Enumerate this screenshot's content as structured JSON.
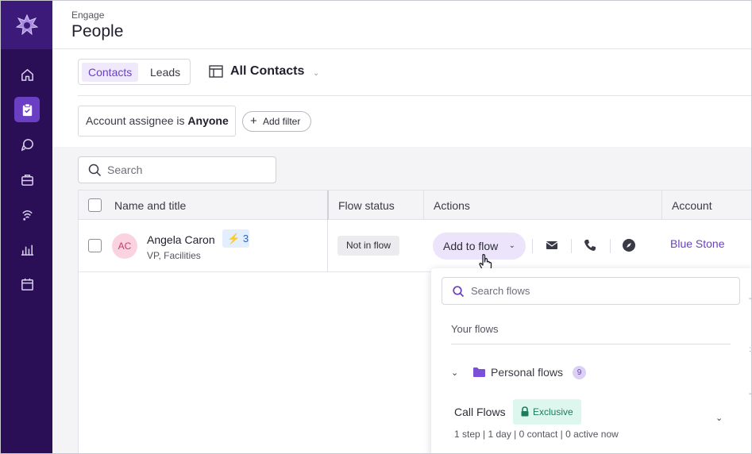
{
  "header": {
    "breadcrumb": "Engage",
    "title": "People"
  },
  "sidebar": {
    "items": [
      {
        "icon": "home-icon",
        "active": false
      },
      {
        "icon": "clipboard-icon",
        "active": true
      },
      {
        "icon": "chat-bubbles-icon",
        "active": false
      },
      {
        "icon": "briefcase-icon",
        "active": false
      },
      {
        "icon": "signal-icon",
        "active": false
      },
      {
        "icon": "bar-chart-icon",
        "active": false
      },
      {
        "icon": "calendar-icon",
        "active": false
      }
    ],
    "colors": {
      "bg": "#2a0f57",
      "active": "#6b3fc4"
    }
  },
  "toolbar": {
    "tabs": [
      {
        "label": "Contacts",
        "selected": true
      },
      {
        "label": "Leads",
        "selected": false
      }
    ],
    "view_title": "All Contacts",
    "filter": {
      "prefix": "Account assignee is",
      "value": "Anyone"
    },
    "add_filter_label": "Add filter"
  },
  "search": {
    "placeholder": "Search"
  },
  "table": {
    "columns": [
      "Name and title",
      "Flow status",
      "Actions",
      "Account"
    ],
    "rows": [
      {
        "initials": "AC",
        "name": "Angela Caron",
        "title": "VP, Facilities",
        "badge_count": "3",
        "flow_status": "Not in flow",
        "action_label": "Add to flow",
        "account": "Blue Stone"
      }
    ]
  },
  "dropdown": {
    "search_placeholder": "Search flows",
    "section_title": "Your flows",
    "folder": {
      "label": "Personal flows",
      "count": "9"
    },
    "flow": {
      "name": "Call Flows",
      "badge": "Exclusive",
      "meta": "1 step | 1 day | 0 contact | 0 active now"
    }
  },
  "accent": "#6b3fc4"
}
